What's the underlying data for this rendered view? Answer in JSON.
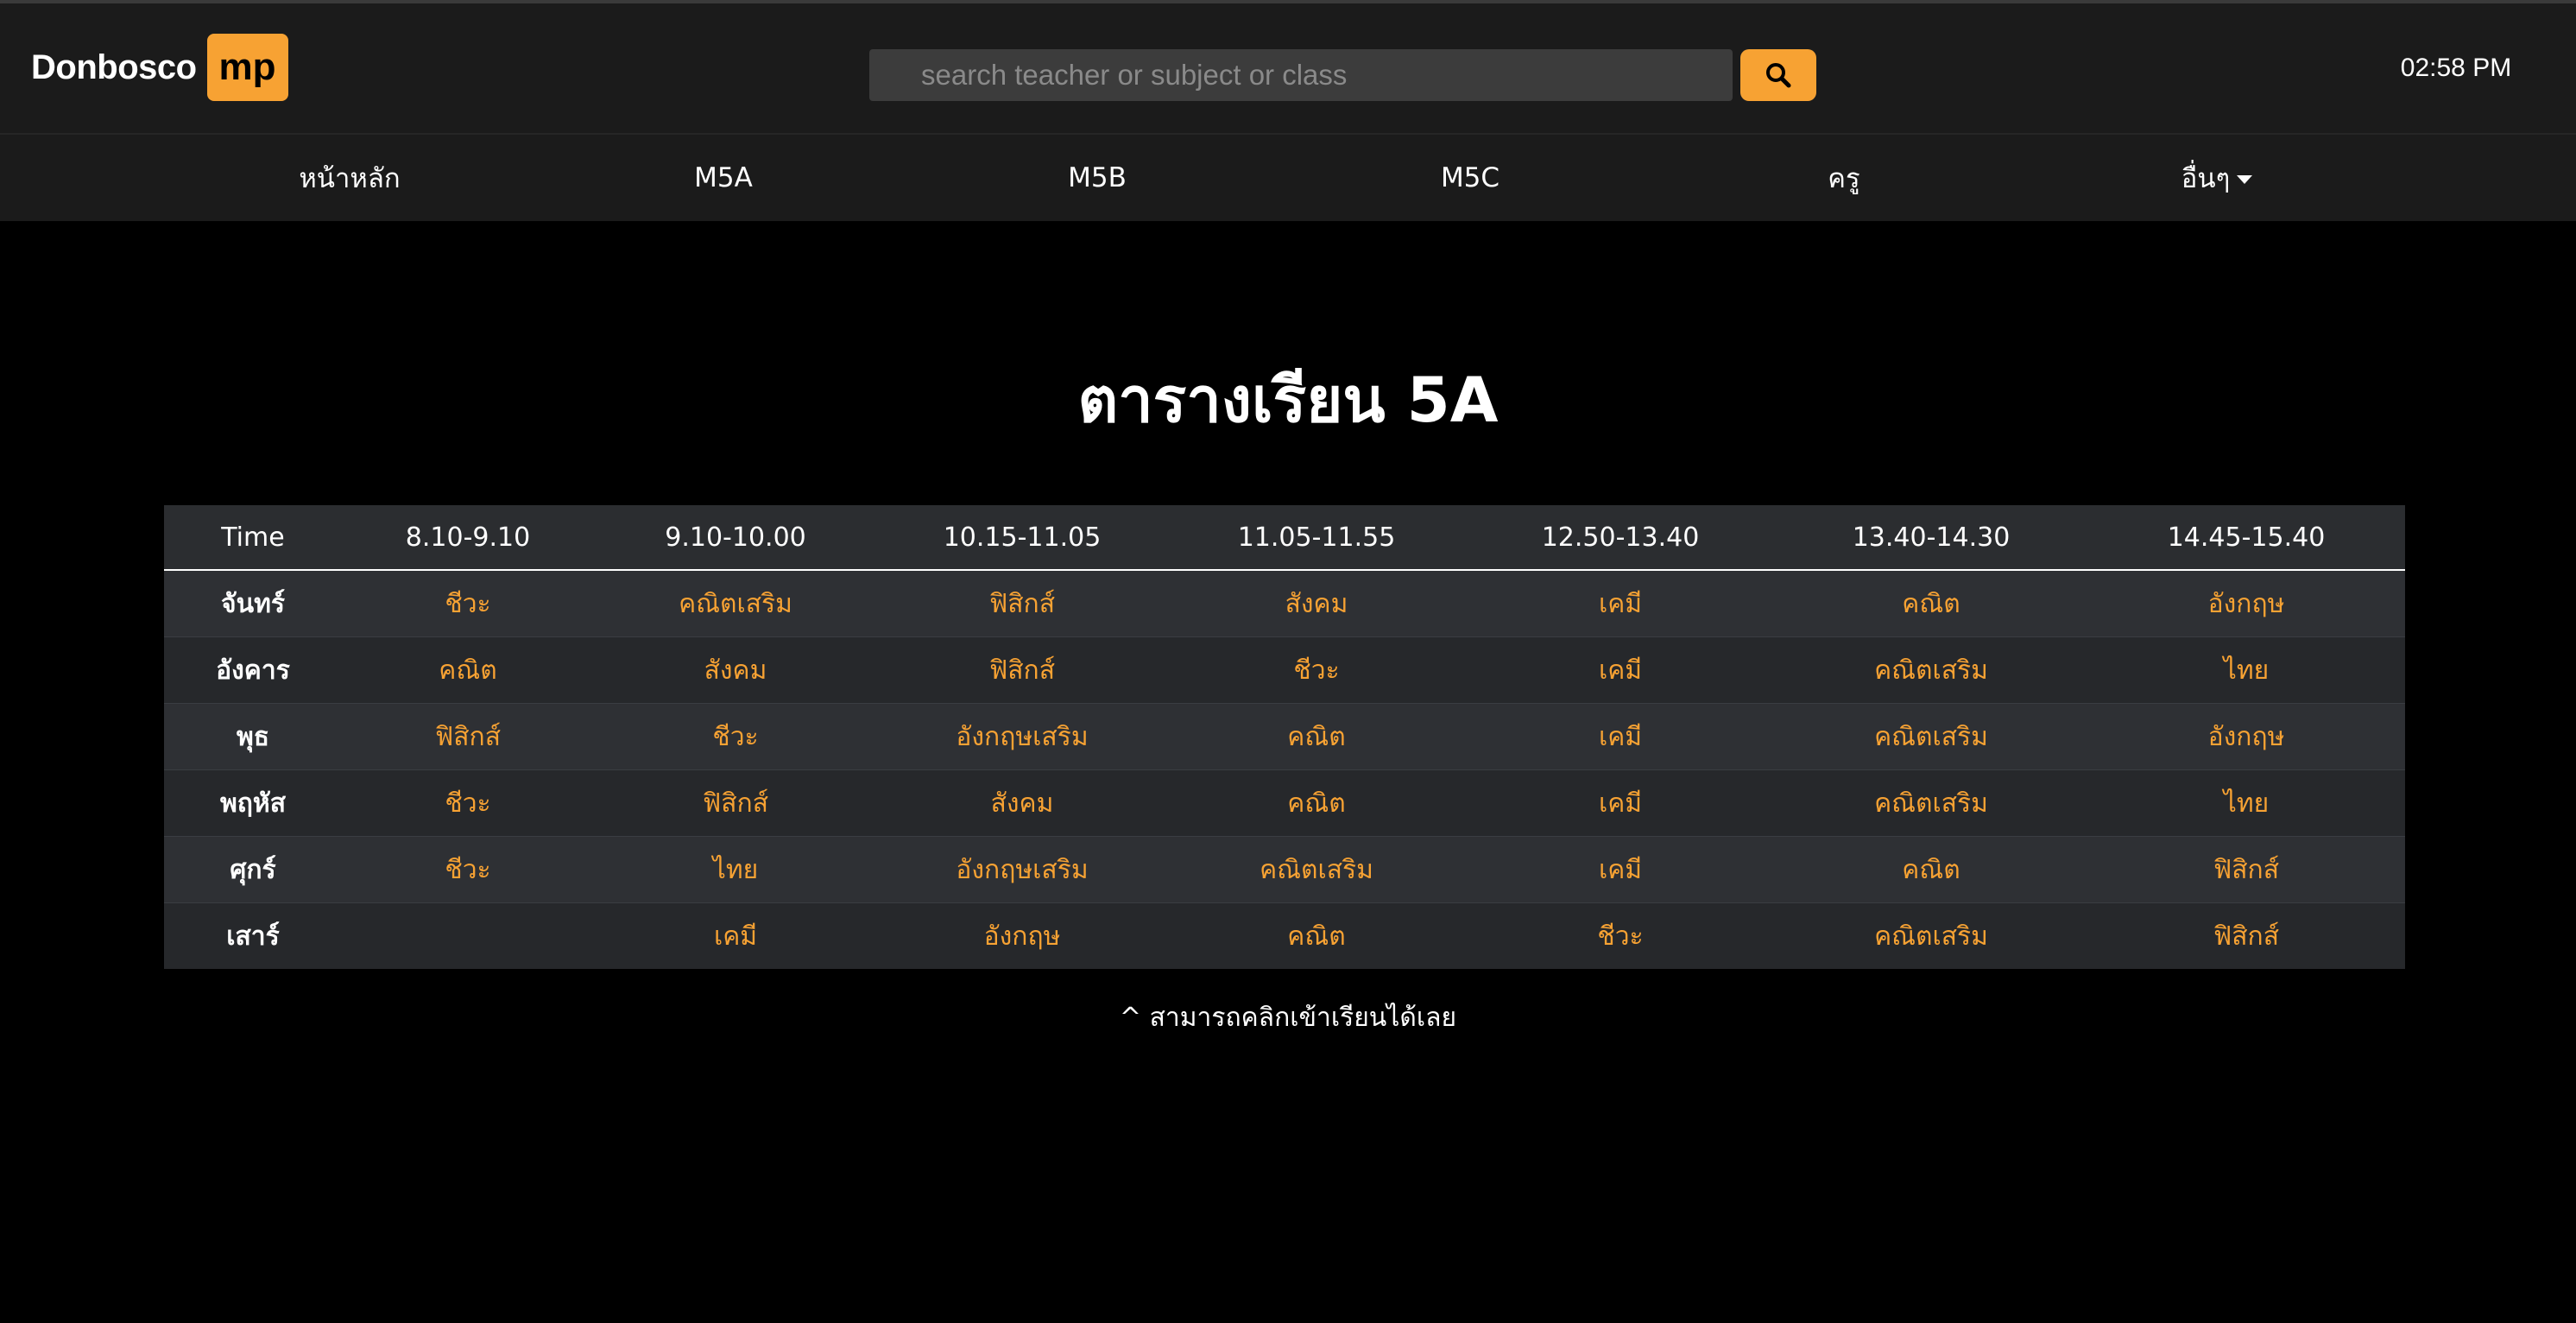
{
  "header": {
    "logo_text": "Donbosco",
    "logo_badge": "mp",
    "search_placeholder": "search teacher or subject or class",
    "search_value": "",
    "search_button_icon": "search-icon",
    "clock": "02:58 PM"
  },
  "nav": {
    "items": [
      {
        "label": "หน้าหลัก"
      },
      {
        "label": "M5A"
      },
      {
        "label": "M5B"
      },
      {
        "label": "M5C"
      },
      {
        "label": "ครู"
      },
      {
        "label": "อื่นๆ",
        "icon": "caret-down-icon"
      }
    ]
  },
  "page_title": "ตารางเรียน 5A",
  "table": {
    "headers": [
      "Time",
      "8.10-9.10",
      "9.10-10.00",
      "10.15-11.05",
      "11.05-11.55",
      "12.50-13.40",
      "13.40-14.30",
      "14.45-15.40"
    ],
    "rows": [
      {
        "day": "จันทร์",
        "cells": [
          "ชีวะ",
          "คณิตเสริม",
          "ฟิสิกส์",
          "สังคม",
          "เคมี",
          "คณิต",
          "อังกฤษ"
        ]
      },
      {
        "day": "อังคาร",
        "cells": [
          "คณิต",
          "สังคม",
          "ฟิสิกส์",
          "ชีวะ",
          "เคมี",
          "คณิตเสริม",
          "ไทย"
        ]
      },
      {
        "day": "พุธ",
        "cells": [
          "ฟิสิกส์",
          "ชีวะ",
          "อังกฤษเสริม",
          "คณิต",
          "เคมี",
          "คณิตเสริม",
          "อังกฤษ"
        ]
      },
      {
        "day": "พฤหัส",
        "cells": [
          "ชีวะ",
          "ฟิสิกส์",
          "สังคม",
          "คณิต",
          "เคมี",
          "คณิตเสริม",
          "ไทย"
        ]
      },
      {
        "day": "ศุกร์",
        "cells": [
          "ชีวะ",
          "ไทย",
          "อังกฤษเสริม",
          "คณิตเสริม",
          "เคมี",
          "คณิต",
          "ฟิสิกส์"
        ]
      },
      {
        "day": "เสาร์",
        "cells": [
          "",
          "เคมี",
          "อังกฤษ",
          "คณิต",
          "ชีวะ",
          "คณิตเสริม",
          "ฟิสิกส์"
        ]
      }
    ]
  },
  "note": "^ สามารถคลิกเข้าเรียนได้เลย",
  "colors": {
    "accent": "#f7a233",
    "header_bg": "#1b1b1b",
    "page_bg": "#000000",
    "table_row_odd": "#2e3034",
    "table_row_even": "#26282b"
  }
}
